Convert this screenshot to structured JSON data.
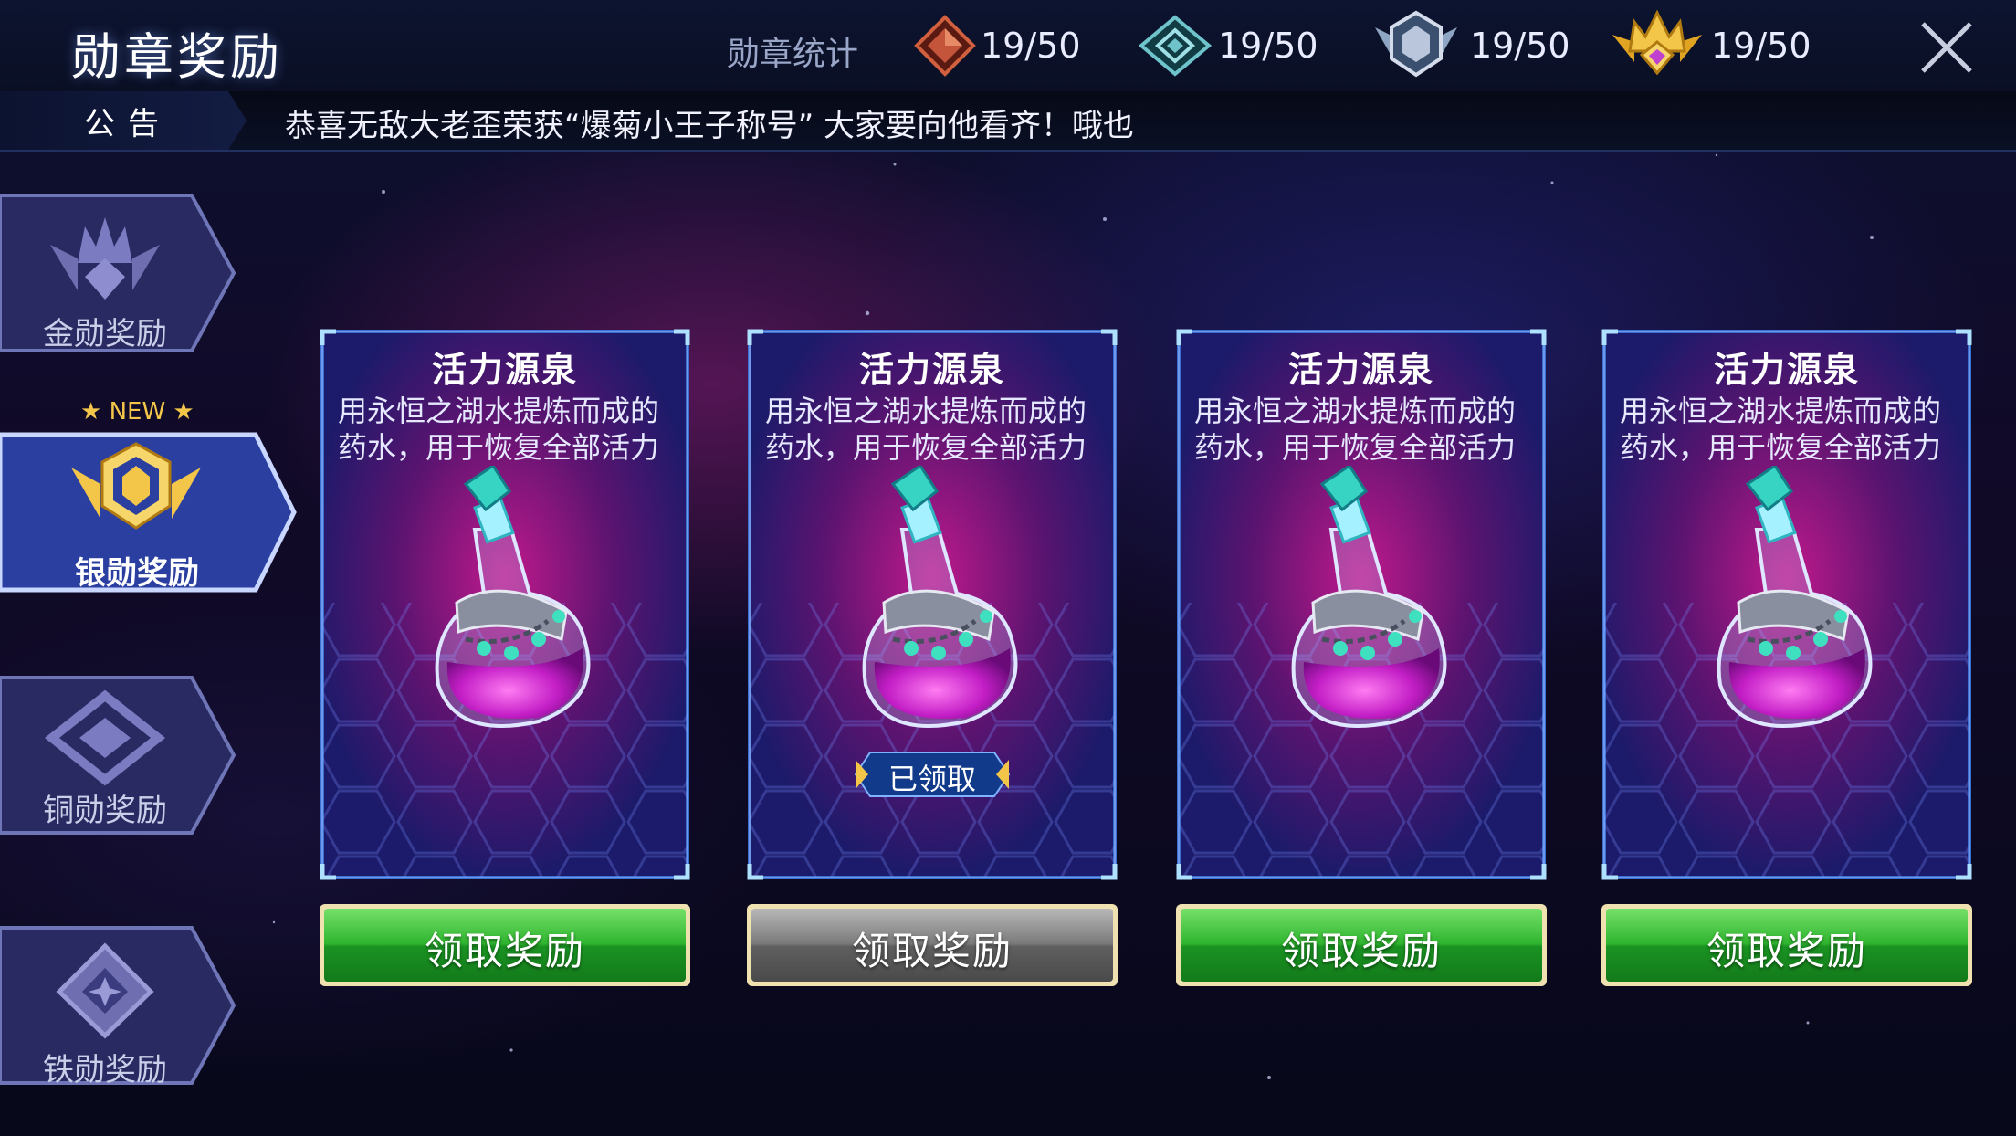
{
  "header": {
    "title": "勋章奖励",
    "stats_label": "勋章统计",
    "stats": [
      {
        "icon": "bronze-medal-icon",
        "value": "19/50"
      },
      {
        "icon": "silver-medal-icon",
        "value": "19/50"
      },
      {
        "icon": "platinum-medal-icon",
        "value": "19/50"
      },
      {
        "icon": "gold-crown-medal-icon",
        "value": "19/50"
      }
    ]
  },
  "notice": {
    "label": "公告",
    "text": "恭喜无敌大老歪荣获“爆菊小王子称号” 大家要向他看齐！哦也"
  },
  "sidebar": {
    "new_badge": "NEW",
    "tabs": [
      {
        "label": "金勋奖励",
        "active": false
      },
      {
        "label": "银勋奖励",
        "active": true
      },
      {
        "label": "铜勋奖励",
        "active": false
      },
      {
        "label": "铁勋奖励",
        "active": false
      }
    ]
  },
  "rewards": [
    {
      "name": "活力源泉",
      "desc_line1": "用永恒之湖水提炼而成的",
      "desc_line2": "药水，用于恢复全部活力",
      "claimed": false,
      "button": "领取奖励"
    },
    {
      "name": "活力源泉",
      "desc_line1": "用永恒之湖水提炼而成的",
      "desc_line2": "药水，用于恢复全部活力",
      "claimed": true,
      "claimed_label": "已领取",
      "button": "领取奖励"
    },
    {
      "name": "活力源泉",
      "desc_line1": "用永恒之湖水提炼而成的",
      "desc_line2": "药水，用于恢复全部活力",
      "claimed": false,
      "button": "领取奖励"
    },
    {
      "name": "活力源泉",
      "desc_line1": "用永恒之湖水提炼而成的",
      "desc_line2": "药水，用于恢复全部活力",
      "claimed": false,
      "button": "领取奖励"
    }
  ],
  "colors": {
    "button_green": "#2fb52f",
    "button_disabled": "#6f6f6f",
    "accent_gold": "#f3c64a",
    "card_frame": "#3a6fd0"
  }
}
